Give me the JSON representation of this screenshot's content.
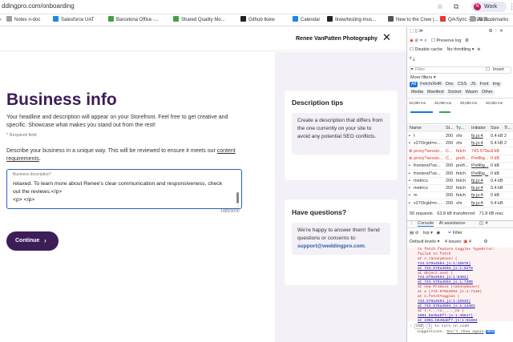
{
  "browser": {
    "url": "ddingpro.com/onboarding",
    "profile_initial": "N",
    "profile_label": "Work",
    "bookmarks": [
      {
        "label": "Notes n-doc",
        "color": "#9e9e9e"
      },
      {
        "label": "Salesforce UAT",
        "color": "#1e88e5"
      },
      {
        "label": "Barcelona Office -...",
        "color": "#43a047"
      },
      {
        "label": "Shared Quality Mo...",
        "color": "#43a047"
      },
      {
        "label": "Github tkww",
        "color": "#222222"
      },
      {
        "label": "Calendar",
        "color": "#1e88e5"
      },
      {
        "label": "tkww/testing-mus...",
        "color": "#222222"
      },
      {
        "label": "New to the Crew |...",
        "color": "#555555"
      },
      {
        "label": "QA Sync - 2025/11...",
        "color": "#e53935"
      }
    ],
    "all_bookmarks": "All Bookmarks"
  },
  "header": {
    "vendor_name": "Renee VanPatten Photography"
  },
  "main": {
    "title": "Business info",
    "intro": "Your headline and description will appear on your Storefront. Feel free to get creative and specific. Showcase what makes you stand out from the rest!",
    "required_note": "* Required field",
    "describe_text": "Describe your business in a unique way. This will be reviewed to ensure it meets our ",
    "content_link": "content requirements",
    "describe_end": ".",
    "field_label": "Business description*",
    "field_value": "relaxed. To learn more about Renee's clear communication and responsiveness, check out the reviews.</p>\n<p> </p>",
    "char_count": "1489/3000",
    "continue_label": "Continue"
  },
  "tips": {
    "title": "Description tips",
    "text": "Create a description that differs from the one currently on your site to avoid any potential SEO conflicts."
  },
  "help": {
    "title": "Have questions?",
    "text": "We're happy to answer them! Send questions or concerns to:",
    "email": "support@weddingpro.com",
    "email_end": "."
  },
  "devtools": {
    "preserve_log": "Preserve log",
    "disable_cache": "Disable cache",
    "throttle": "No throttling",
    "filter_placeholder": "Filter",
    "invert": "Invert",
    "more_filters": "More filters",
    "type_filters_1": [
      "All",
      "Fetch/XHR",
      "Doc",
      "CSS",
      "JS",
      "Font",
      "Img"
    ],
    "type_filters_2": [
      "Media",
      "Manifest",
      "Socket",
      "Wasm",
      "Other"
    ],
    "timeline": [
      "10,000 ms",
      "20,000 ms",
      "30,000 ms",
      "40,000 ms"
    ],
    "columns": [
      "Name",
      "St...",
      "Ty...",
      "Initiator",
      "Size",
      "Ti..."
    ],
    "rows": [
      {
        "name": "t",
        "status": "200",
        "type": "xhr",
        "initiator": "fp.js:4",
        "size": "0.4 kB",
        "time": "2",
        "error": false
      },
      {
        "name": "v27Orgid=o-...",
        "status": "200",
        "type": "xhr",
        "initiator": "fp.js:4",
        "size": "0.4 kB",
        "time": "2",
        "error": false
      },
      {
        "name": "proxy?sessio...",
        "status": "C...",
        "type": "fetch",
        "initiator": "743.579a...",
        "size": "0 kB",
        "time": "",
        "error": true
      },
      {
        "name": "proxy?sessio...",
        "status": "C...",
        "type": "prefl...",
        "initiator": "Prefilig...",
        "size": "0 kB",
        "time": "",
        "error": true
      },
      {
        "name": "frontend?se...",
        "status": "200",
        "type": "prefl...",
        "initiator": "Prefilig...",
        "size": "0 kB",
        "time": "",
        "error": false
      },
      {
        "name": "frontend?se...",
        "status": "200",
        "type": "fetch",
        "initiator": "Prefilig...",
        "size": "0 kB",
        "time": "",
        "error": false
      },
      {
        "name": "metrics",
        "status": "200",
        "type": "fetch",
        "initiator": "fp.js:4",
        "size": "0.4 kB",
        "time": "",
        "error": false
      },
      {
        "name": "metrics",
        "status": "202",
        "type": "fetch",
        "initiator": "fp.js:4",
        "size": "0.4 kB",
        "time": "",
        "error": false
      },
      {
        "name": "m",
        "status": "200",
        "type": "fetch",
        "initiator": "fp.js:4",
        "size": "0 kB",
        "time": "",
        "error": false
      },
      {
        "name": "v27Orgid=o-...",
        "status": "200",
        "type": "xhr",
        "initiator": "fp.js:4",
        "size": "0.4 kB",
        "time": "",
        "error": false
      }
    ],
    "summary_requests": "56 requests",
    "summary_transferred": "63.8 kB transferred",
    "summary_resources": "71.8 kB resc",
    "console_tab": "Console",
    "ai_tab": "AI assistance",
    "top_label": "top",
    "default_levels": "Default levels",
    "issues": "4 issues:",
    "issues_count": "4",
    "console_lines": [
      {
        "text": "to fetch feature toggles TypeError:",
        "link": false
      },
      {
        "text": "failed to fetch",
        "link": false
      },
      {
        "text": "    at n.<anonymous> (",
        "link": false
      },
      {
        "text": "743.579a4594.js:1:15878)",
        "link": true
      },
      {
        "text": "    at 743.579a4594.js:1:8278",
        "link": true
      },
      {
        "text": "    at Object.next (",
        "link": false
      },
      {
        "text": "743.579a4594.js:1:8403)",
        "link": true
      },
      {
        "text": "    at 743.579a4594.js:1:7395",
        "link": true
      },
      {
        "text": "    at new Promise (<anonymous>)",
        "link": false
      },
      {
        "text": "    at a (743.579a4594.js:1:7148)",
        "link": false
      },
      {
        "text": "    at n.fetchToggles (",
        "link": false
      },
      {
        "text": "743.579a4594.js:1:15542)",
        "link": true
      },
      {
        "text": "    at 743.579a4594.js:1:14481",
        "link": true
      },
      {
        "text": "    at t.<...>o._..._no (",
        "link": false
      },
      {
        "text": "1001.b646abf7.js:1:49817)",
        "link": true
      },
      {
        "text": "    at 1001.b646abf7.js:1:51894",
        "link": true
      }
    ],
    "prompt_hint_1": "cmd",
    "prompt_hint_2": "i",
    "prompt_text": " to turn on code",
    "prompt_text_2": "suggestions. ",
    "dont_show": "Don't show again",
    "new_badge": "NEW"
  }
}
